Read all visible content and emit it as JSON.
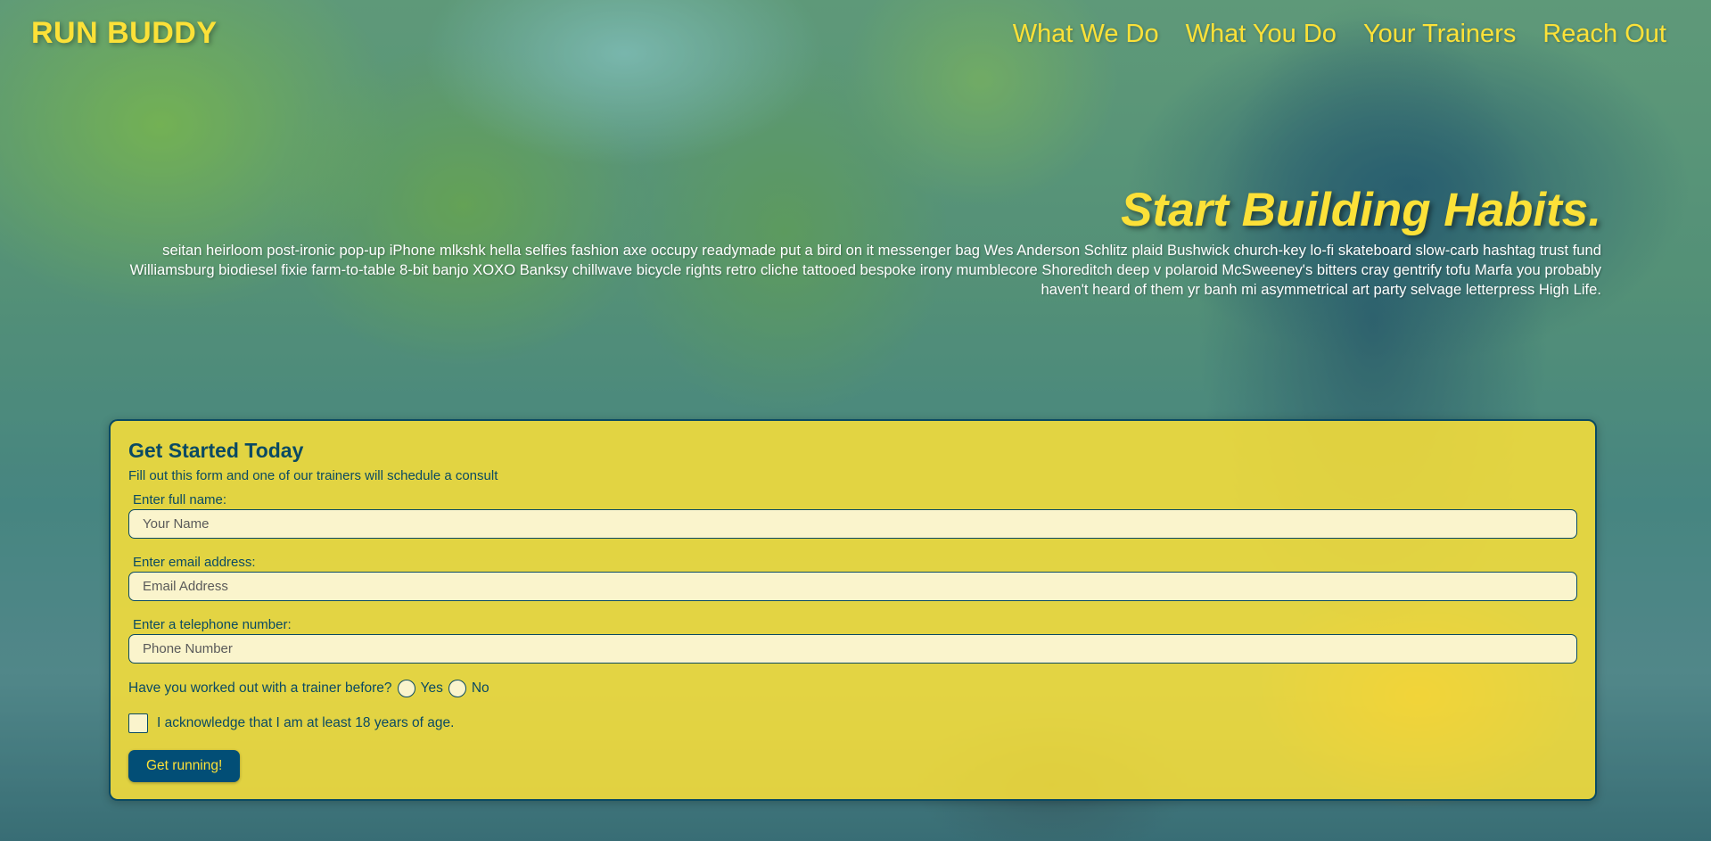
{
  "header": {
    "logo": "RUN BUDDY",
    "nav": [
      {
        "label": "What We Do"
      },
      {
        "label": "What You Do"
      },
      {
        "label": "Your Trainers"
      },
      {
        "label": "Reach Out"
      }
    ]
  },
  "hero": {
    "title": "Start Building Habits.",
    "body": "seitan heirloom post-ironic pop-up iPhone mlkshk hella selfies fashion axe occupy readymade put a bird on it messenger bag Wes Anderson Schlitz plaid Bushwick church-key lo-fi skateboard slow-carb hashtag trust fund Williamsburg biodiesel fixie farm-to-table 8-bit banjo XOXO Banksy chillwave bicycle rights retro cliche tattooed bespoke irony mumblecore Shoreditch deep v polaroid McSweeney's bitters cray gentrify tofu Marfa you probably haven't heard of them yr banh mi asymmetrical art party selvage letterpress High Life."
  },
  "form": {
    "title": "Get Started Today",
    "subtitle": "Fill out this form and one of our trainers will schedule a consult",
    "name": {
      "label": "Enter full name:",
      "placeholder": "Your Name",
      "value": ""
    },
    "email": {
      "label": "Enter email address:",
      "placeholder": "Email Address",
      "value": ""
    },
    "phone": {
      "label": "Enter a telephone number:",
      "placeholder": "Phone Number",
      "value": ""
    },
    "trainer_question": {
      "label": "Have you worked out with a trainer before?",
      "yes": "Yes",
      "no": "No"
    },
    "acknowledge": "I acknowledge that I am at least 18 years of age.",
    "submit": "Get running!"
  },
  "colors": {
    "accent_yellow": "#fce138",
    "dark_blue": "#024e76",
    "input_bg": "#faf4cc"
  }
}
